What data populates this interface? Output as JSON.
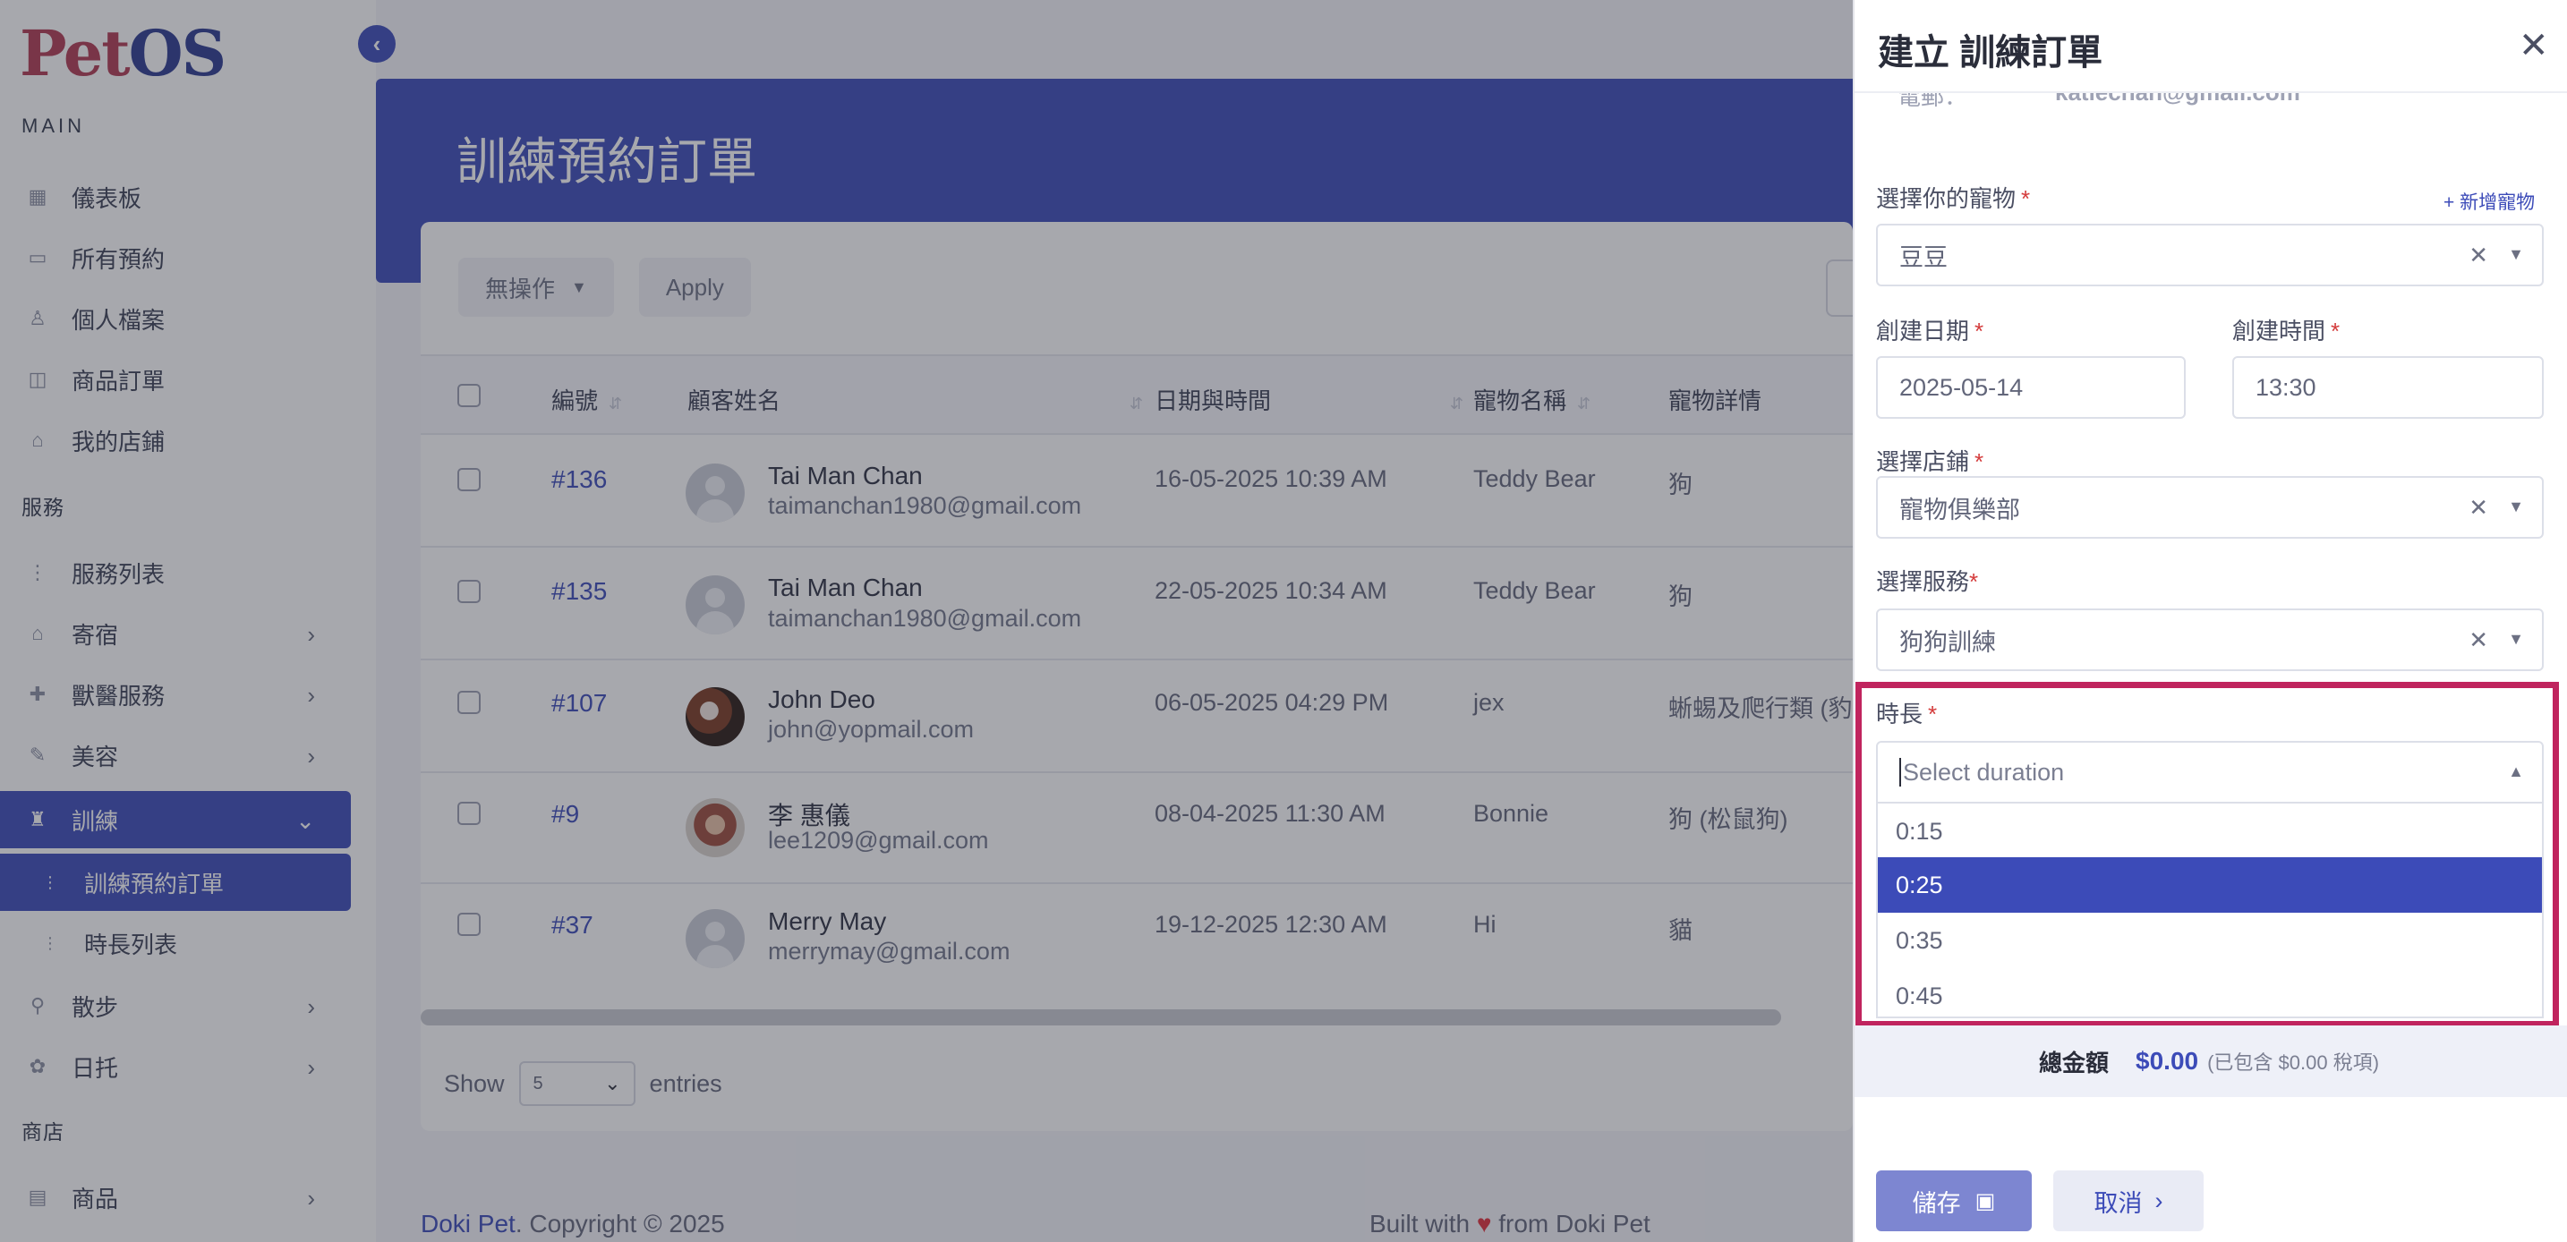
{
  "app": {
    "logo_pet": "Pet",
    "logo_os": "OS"
  },
  "sidebar": {
    "main_label": "MAIN",
    "items": [
      {
        "label": "儀表板",
        "icon": "dashboard-icon"
      },
      {
        "label": "所有預約",
        "icon": "calendar-icon"
      },
      {
        "label": "個人檔案",
        "icon": "user-icon"
      },
      {
        "label": "商品訂單",
        "icon": "bag-icon"
      },
      {
        "label": "我的店鋪",
        "icon": "store-icon"
      }
    ],
    "services_label": "服務",
    "service_items": [
      {
        "label": "服務列表",
        "icon": "list-icon"
      },
      {
        "label": "寄宿",
        "icon": "home-icon"
      },
      {
        "label": "獸醫服務",
        "icon": "vet-icon"
      },
      {
        "label": "美容",
        "icon": "brush-icon"
      },
      {
        "label": "訓練",
        "icon": "training-icon"
      },
      {
        "label": "訓練預約訂單",
        "icon": "list-icon"
      },
      {
        "label": "時長列表",
        "icon": "list-icon"
      },
      {
        "label": "散步",
        "icon": "walk-icon"
      },
      {
        "label": "日托",
        "icon": "daycare-icon"
      }
    ],
    "shop_label": "商店",
    "shop_items": [
      {
        "label": "商品",
        "icon": "shop-icon"
      }
    ]
  },
  "main": {
    "title": "訓練預約訂單",
    "bulk_action": "無操作",
    "apply": "Apply",
    "columns": [
      "編號",
      "顧客姓名",
      "日期與時間",
      "寵物名稱",
      "寵物詳情"
    ],
    "rows": [
      {
        "id": "#136",
        "name": "Tai Man Chan",
        "email": "taimanchan1980@gmail.com",
        "datetime": "16-05-2025 10:39 AM",
        "pet": "Teddy Bear",
        "detail": "狗"
      },
      {
        "id": "#135",
        "name": "Tai Man Chan",
        "email": "taimanchan1980@gmail.com",
        "datetime": "22-05-2025 10:34 AM",
        "pet": "Teddy Bear",
        "detail": "狗"
      },
      {
        "id": "#107",
        "name": "John Deo",
        "email": "john@yopmail.com",
        "datetime": "06-05-2025 04:29 PM",
        "pet": "jex",
        "detail": "蜥蜴及爬行類 (豹紋"
      },
      {
        "id": "#9",
        "name": "李 惠儀",
        "email": "lee1209@gmail.com",
        "datetime": "08-04-2025 11:30 AM",
        "pet": "Bonnie",
        "detail": "狗 (松鼠狗)"
      },
      {
        "id": "#37",
        "name": "Merry May",
        "email": "merrymay@gmail.com",
        "datetime": "19-12-2025 12:30 AM",
        "pet": "Hi",
        "detail": "貓"
      }
    ],
    "show_label": "Show",
    "entries_value": "5",
    "entries_label": "entries"
  },
  "footer": {
    "brand": "Doki Pet",
    "copyright": ". Copyright © 2025",
    "built_prefix": "Built with ",
    "built_suffix": " from Doki Pet"
  },
  "drawer": {
    "title": "建立 訓練訂單",
    "cut_label": "電郵：",
    "cut_email": "katiechan@gmail.com",
    "pet_label": "選擇你的寵物",
    "add_pet": "+ 新增寵物",
    "pet_value": "豆豆",
    "date_label": "創建日期",
    "date_value": "2025-05-14",
    "time_label": "創建時間",
    "time_value": "13:30",
    "store_label": "選擇店鋪",
    "store_value": "寵物俱樂部",
    "service_label": "選擇服務",
    "service_value": "狗狗訓練",
    "duration_label": "時長",
    "duration_placeholder": "Select duration",
    "duration_options": [
      "0:15",
      "0:25",
      "0:35",
      "0:45"
    ],
    "duration_highlighted": "0:25",
    "total_label": "總金額",
    "total_amount": "$0.00",
    "total_tax": "(已包含 $0.00 稅項)",
    "save": "儲存",
    "cancel": "取消"
  },
  "colors": {
    "primary": "#3c4bb8",
    "highlight_border": "#c0245e",
    "required": "#d43b3b"
  }
}
